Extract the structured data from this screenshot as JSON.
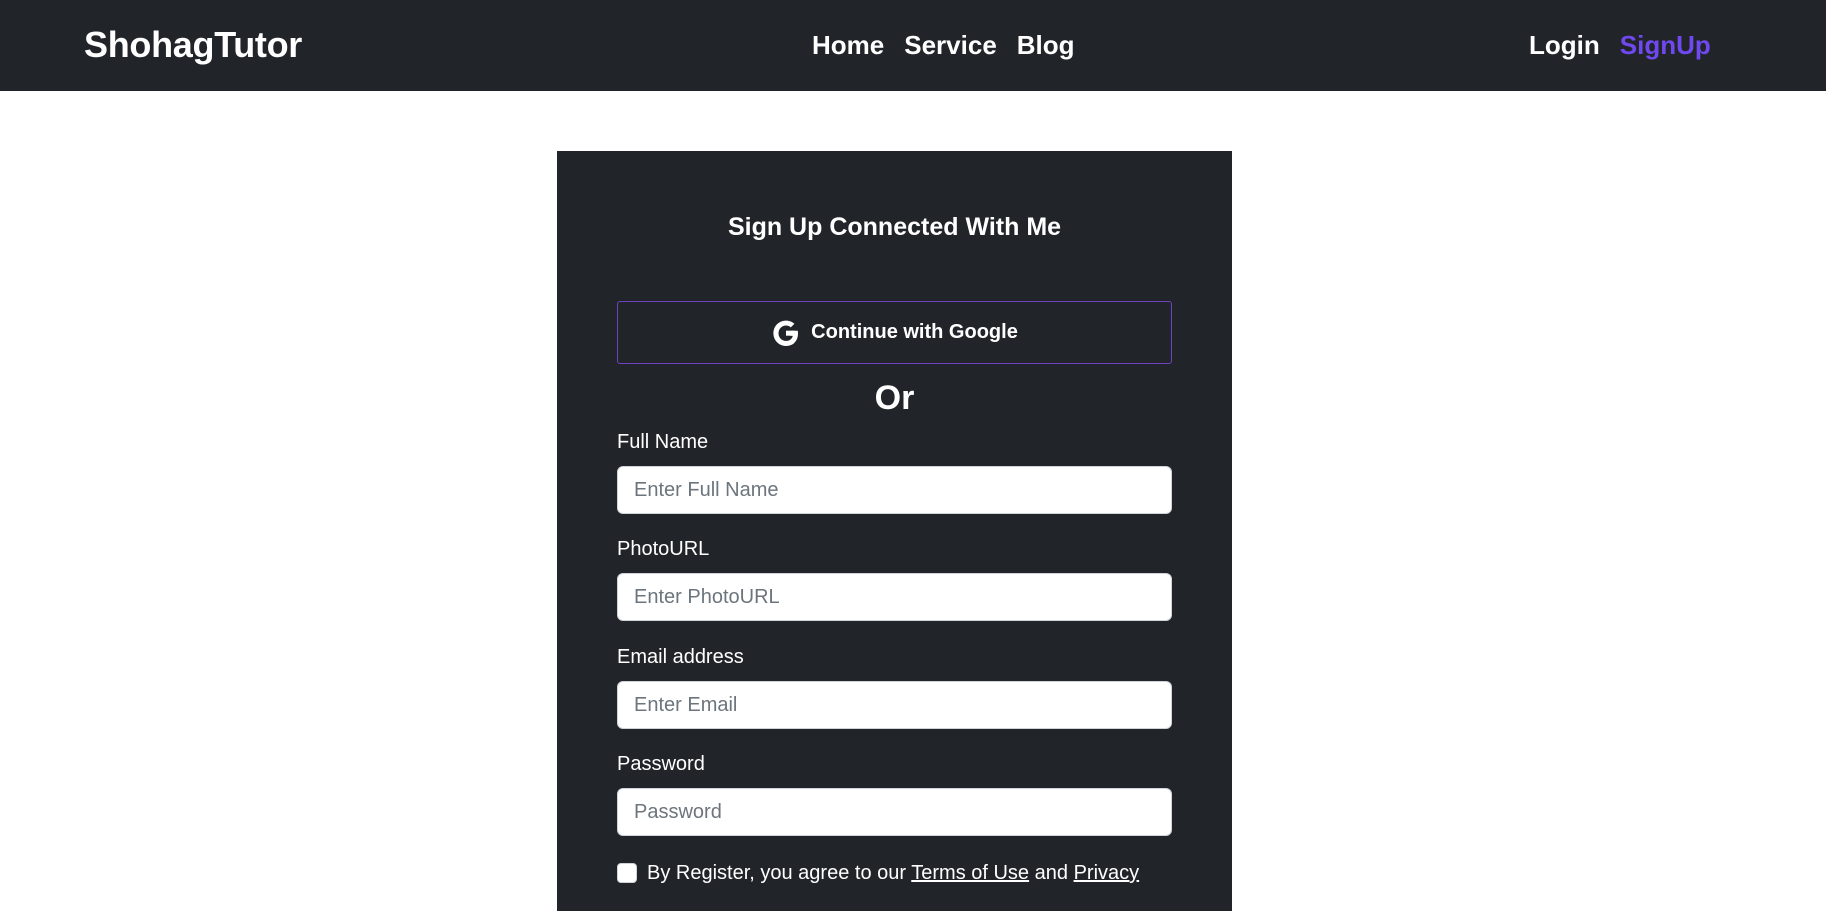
{
  "navbar": {
    "brand": "ShohagTutor",
    "links": [
      {
        "label": "Home"
      },
      {
        "label": "Service"
      },
      {
        "label": "Blog"
      }
    ],
    "auth": [
      {
        "label": "Login"
      },
      {
        "label": "SignUp"
      }
    ],
    "accent_color": "#7048f0",
    "background": "#212529"
  },
  "form": {
    "title": "Sign Up Connected With Me",
    "google_button": {
      "label": "Continue with Google",
      "icon": "google-icon",
      "border_color": "#6f42c1"
    },
    "divider": "Or",
    "fields": [
      {
        "label": "Full Name",
        "placeholder": "Enter Full Name",
        "value": ""
      },
      {
        "label": "PhotoURL",
        "placeholder": "Enter PhotoURL",
        "value": ""
      },
      {
        "label": "Email address",
        "placeholder": "Enter Email",
        "value": ""
      },
      {
        "label": "Password",
        "placeholder": "Password",
        "value": ""
      }
    ],
    "agreement": {
      "prefix": "By Register, you agree to our",
      "terms_link": "Terms of Use",
      "conjunction": "and",
      "privacy_link": "Privacy",
      "checked": false
    }
  }
}
